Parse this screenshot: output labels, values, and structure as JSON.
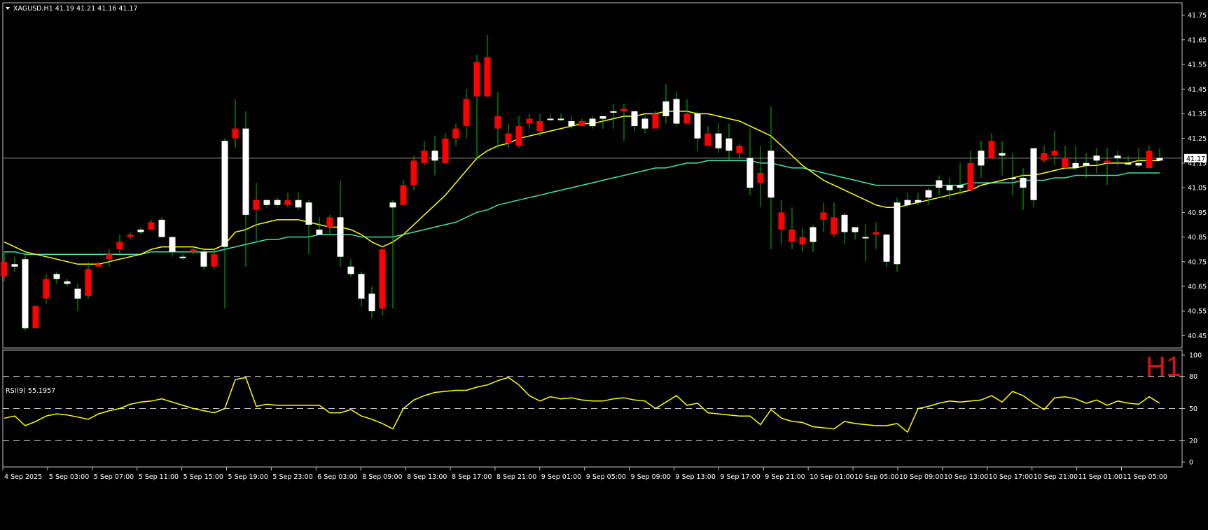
{
  "header": {
    "symbol_text": "XAGUSD,H1  41.19 41.21 41.16 41.17",
    "timeframe": "H1",
    "last_price_label": "41.17"
  },
  "rsi": {
    "label": "RSI(9) 55.1957",
    "levels": [
      80,
      50,
      20
    ],
    "axis_labels": [
      "100",
      "80",
      "50",
      "20",
      "0"
    ]
  },
  "colors": {
    "background": "#000000",
    "frame": "#c0c0c0",
    "bull_candle": "#ffffff",
    "bear_candle": "#ff0000",
    "wick": "#00c000",
    "ma_fast": "#ffff00",
    "ma_slow": "#40e0b0",
    "rsi_line": "#ffff00",
    "timeframe_label": "#e01010"
  },
  "chart_data": [
    {
      "type": "candlestick",
      "symbol": "XAGUSD",
      "ylim": [
        40.4,
        41.8
      ],
      "y_ticks": [
        "41.75",
        "41.65",
        "41.55",
        "41.45",
        "41.35",
        "41.25",
        "41.15",
        "41.05",
        "40.95",
        "40.85",
        "40.75",
        "40.65",
        "40.55",
        "40.45"
      ],
      "x_tick_labels": [
        "4 Sep 2025",
        "5 Sep 03:00",
        "5 Sep 07:00",
        "5 Sep 11:00",
        "5 Sep 15:00",
        "5 Sep 19:00",
        "5 Sep 23:00",
        "6 Sep 03:00",
        "8 Sep 09:00",
        "8 Sep 13:00",
        "8 Sep 17:00",
        "8 Sep 21:00",
        "9 Sep 01:00",
        "9 Sep 05:00",
        "9 Sep 09:00",
        "9 Sep 13:00",
        "9 Sep 17:00",
        "9 Sep 21:00",
        "10 Sep 01:00",
        "10 Sep 05:00",
        "10 Sep 09:00",
        "10 Sep 13:00",
        "10 Sep 17:00",
        "10 Sep 21:00",
        "11 Sep 01:00",
        "11 Sep 05:00"
      ],
      "last_price": 41.17,
      "ohlc": [
        [
          40.75,
          40.79,
          40.67,
          40.69
        ],
        [
          40.73,
          40.77,
          40.71,
          40.74
        ],
        [
          40.48,
          40.79,
          40.47,
          40.76
        ],
        [
          40.57,
          40.57,
          40.48,
          40.48
        ],
        [
          40.68,
          40.7,
          40.58,
          40.6
        ],
        [
          40.68,
          40.71,
          40.66,
          40.7
        ],
        [
          40.66,
          40.68,
          40.65,
          40.67
        ],
        [
          40.6,
          40.66,
          40.55,
          40.64
        ],
        [
          40.72,
          40.75,
          40.6,
          40.61
        ],
        [
          40.74,
          40.75,
          40.73,
          40.73
        ],
        [
          40.78,
          40.8,
          40.73,
          40.76
        ],
        [
          40.83,
          40.86,
          40.78,
          40.8
        ],
        [
          40.86,
          40.87,
          40.84,
          40.85
        ],
        [
          40.87,
          40.89,
          40.86,
          40.88
        ],
        [
          40.91,
          40.92,
          40.88,
          40.88
        ],
        [
          40.85,
          40.93,
          40.85,
          40.92
        ],
        [
          40.79,
          40.85,
          40.77,
          40.85
        ],
        [
          40.77,
          40.78,
          40.76,
          40.77
        ],
        [
          40.8,
          40.81,
          40.78,
          40.79
        ],
        [
          40.73,
          40.8,
          40.72,
          40.79
        ],
        [
          40.78,
          40.8,
          40.72,
          40.73
        ],
        [
          40.81,
          41.25,
          40.56,
          41.24
        ],
        [
          41.29,
          41.41,
          41.21,
          41.25
        ],
        [
          40.94,
          41.36,
          40.73,
          41.29
        ],
        [
          41.0,
          41.07,
          40.83,
          40.96
        ],
        [
          40.98,
          41.0,
          40.97,
          41.0
        ],
        [
          40.98,
          41.01,
          40.97,
          41.0
        ],
        [
          41.0,
          41.03,
          40.97,
          40.98
        ],
        [
          40.97,
          41.03,
          40.96,
          41.0
        ],
        [
          40.9,
          41.0,
          40.78,
          40.99
        ],
        [
          40.86,
          40.93,
          40.86,
          40.88
        ],
        [
          40.93,
          40.94,
          40.86,
          40.89
        ],
        [
          40.77,
          41.08,
          40.73,
          40.93
        ],
        [
          40.7,
          40.76,
          40.69,
          40.73
        ],
        [
          40.6,
          40.71,
          40.57,
          40.7
        ],
        [
          40.55,
          40.65,
          40.52,
          40.62
        ],
        [
          40.8,
          40.8,
          40.53,
          40.56
        ],
        [
          40.97,
          41.0,
          40.56,
          40.99
        ],
        [
          41.06,
          41.08,
          40.98,
          40.98
        ],
        [
          41.16,
          41.18,
          41.04,
          41.06
        ],
        [
          41.2,
          41.24,
          41.14,
          41.15
        ],
        [
          41.16,
          41.26,
          41.1,
          41.2
        ],
        [
          41.25,
          41.27,
          41.15,
          41.15
        ],
        [
          41.29,
          41.31,
          41.22,
          41.25
        ],
        [
          41.41,
          41.45,
          41.25,
          41.3
        ],
        [
          41.56,
          41.59,
          41.16,
          41.42
        ],
        [
          41.58,
          41.67,
          41.42,
          41.42
        ],
        [
          41.34,
          41.44,
          41.21,
          41.29
        ],
        [
          41.27,
          41.31,
          41.21,
          41.23
        ],
        [
          41.3,
          41.34,
          41.21,
          41.22
        ],
        [
          41.33,
          41.35,
          41.29,
          41.31
        ],
        [
          41.32,
          41.35,
          41.26,
          41.28
        ],
        [
          41.33,
          41.35,
          41.32,
          41.33
        ],
        [
          41.33,
          41.35,
          41.32,
          41.33
        ],
        [
          41.3,
          41.34,
          41.29,
          41.32
        ],
        [
          41.32,
          41.33,
          41.3,
          41.3
        ],
        [
          41.3,
          41.34,
          41.29,
          41.33
        ],
        [
          41.33,
          41.34,
          41.29,
          41.34
        ],
        [
          41.36,
          41.39,
          41.29,
          41.36
        ],
        [
          41.37,
          41.39,
          41.24,
          41.36
        ],
        [
          41.3,
          41.36,
          41.28,
          41.36
        ],
        [
          41.29,
          41.34,
          41.27,
          41.33
        ],
        [
          41.35,
          41.36,
          41.29,
          41.29
        ],
        [
          41.34,
          41.47,
          41.31,
          41.4
        ],
        [
          41.31,
          41.44,
          41.3,
          41.41
        ],
        [
          41.35,
          41.41,
          41.31,
          41.31
        ],
        [
          41.25,
          41.36,
          41.2,
          41.35
        ],
        [
          41.27,
          41.3,
          41.22,
          41.22
        ],
        [
          41.21,
          41.31,
          41.19,
          41.27
        ],
        [
          41.2,
          41.31,
          41.16,
          41.25
        ],
        [
          41.22,
          41.23,
          41.17,
          41.19
        ],
        [
          41.05,
          41.29,
          41.02,
          41.17
        ],
        [
          41.11,
          41.22,
          40.97,
          41.07
        ],
        [
          41.01,
          41.38,
          40.8,
          41.2
        ],
        [
          40.95,
          41.0,
          40.82,
          40.88
        ],
        [
          40.88,
          40.97,
          40.8,
          40.83
        ],
        [
          40.85,
          40.89,
          40.79,
          40.82
        ],
        [
          40.83,
          40.9,
          40.79,
          40.89
        ],
        [
          40.95,
          40.99,
          40.87,
          40.92
        ],
        [
          40.93,
          40.99,
          40.85,
          40.86
        ],
        [
          40.87,
          40.95,
          40.82,
          40.94
        ],
        [
          40.87,
          40.89,
          40.84,
          40.89
        ],
        [
          40.85,
          40.9,
          40.75,
          40.85
        ],
        [
          40.87,
          40.91,
          40.8,
          40.86
        ],
        [
          40.75,
          40.86,
          40.73,
          40.86
        ],
        [
          40.74,
          41.01,
          40.71,
          40.99
        ],
        [
          40.98,
          41.03,
          40.97,
          41.0
        ],
        [
          40.99,
          41.03,
          40.98,
          41.0
        ],
        [
          41.01,
          41.05,
          40.98,
          41.04
        ],
        [
          41.05,
          41.1,
          41.02,
          41.08
        ],
        [
          41.04,
          41.09,
          41.0,
          41.06
        ],
        [
          41.05,
          41.15,
          41.02,
          41.06
        ],
        [
          41.15,
          41.2,
          41.04,
          41.04
        ],
        [
          41.14,
          41.24,
          41.09,
          41.2
        ],
        [
          41.24,
          41.27,
          41.18,
          41.17
        ],
        [
          41.18,
          41.24,
          41.1,
          41.19
        ],
        [
          41.09,
          41.19,
          41.02,
          41.09
        ],
        [
          41.05,
          41.13,
          40.96,
          41.09
        ],
        [
          41.0,
          41.21,
          40.97,
          41.21
        ],
        [
          41.19,
          41.22,
          41.15,
          41.16
        ],
        [
          41.2,
          41.28,
          41.14,
          41.18
        ],
        [
          41.17,
          41.22,
          41.14,
          41.13
        ],
        [
          41.13,
          41.22,
          41.12,
          41.15
        ],
        [
          41.14,
          41.19,
          41.09,
          41.15
        ],
        [
          41.16,
          41.21,
          41.11,
          41.18
        ],
        [
          41.16,
          41.21,
          41.06,
          41.15
        ],
        [
          41.17,
          41.2,
          41.14,
          41.18
        ],
        [
          41.15,
          41.18,
          41.14,
          41.15
        ],
        [
          41.14,
          41.21,
          41.13,
          41.15
        ],
        [
          41.2,
          41.22,
          41.13,
          41.13
        ],
        [
          41.16,
          41.21,
          41.16,
          41.17
        ]
      ],
      "ma_fast": [
        40.83,
        40.81,
        40.79,
        40.78,
        40.77,
        40.76,
        40.75,
        40.74,
        40.74,
        40.74,
        40.75,
        40.76,
        40.77,
        40.78,
        40.8,
        40.81,
        40.81,
        40.81,
        40.81,
        40.8,
        40.8,
        40.82,
        40.87,
        40.88,
        40.9,
        40.91,
        40.92,
        40.92,
        40.92,
        40.91,
        40.9,
        40.89,
        40.89,
        40.88,
        40.86,
        40.83,
        40.81,
        40.83,
        40.86,
        40.9,
        40.94,
        40.98,
        41.02,
        41.07,
        41.12,
        41.17,
        41.2,
        41.22,
        41.23,
        41.25,
        41.26,
        41.27,
        41.28,
        41.29,
        41.3,
        41.31,
        41.31,
        41.32,
        41.33,
        41.34,
        41.34,
        41.35,
        41.35,
        41.36,
        41.36,
        41.36,
        41.35,
        41.35,
        41.34,
        41.33,
        41.32,
        41.3,
        41.28,
        41.26,
        41.22,
        41.18,
        41.14,
        41.11,
        41.08,
        41.06,
        41.04,
        41.02,
        41.0,
        40.98,
        40.97,
        40.97,
        40.98,
        40.99,
        41.0,
        41.01,
        41.02,
        41.03,
        41.04,
        41.06,
        41.07,
        41.08,
        41.09,
        41.1,
        41.1,
        41.11,
        41.12,
        41.13,
        41.13,
        41.14,
        41.14,
        41.15,
        41.15,
        41.15,
        41.16,
        41.16,
        41.16
      ],
      "ma_slow": [
        40.79,
        40.79,
        40.78,
        40.78,
        40.78,
        40.78,
        40.78,
        40.78,
        40.78,
        40.78,
        40.78,
        40.78,
        40.78,
        40.78,
        40.79,
        40.79,
        40.79,
        40.79,
        40.79,
        40.79,
        40.79,
        40.8,
        40.81,
        40.82,
        40.83,
        40.84,
        40.84,
        40.85,
        40.85,
        40.85,
        40.86,
        40.86,
        40.86,
        40.86,
        40.85,
        40.85,
        40.85,
        40.85,
        40.86,
        40.87,
        40.88,
        40.89,
        40.9,
        40.91,
        40.93,
        40.95,
        40.96,
        40.98,
        40.99,
        41.0,
        41.01,
        41.02,
        41.03,
        41.04,
        41.05,
        41.06,
        41.07,
        41.08,
        41.09,
        41.1,
        41.11,
        41.12,
        41.13,
        41.13,
        41.14,
        41.15,
        41.15,
        41.16,
        41.16,
        41.16,
        41.16,
        41.16,
        41.15,
        41.15,
        41.14,
        41.13,
        41.13,
        41.12,
        41.11,
        41.1,
        41.09,
        41.08,
        41.07,
        41.06,
        41.06,
        41.06,
        41.06,
        41.06,
        41.06,
        41.06,
        41.06,
        41.06,
        41.07,
        41.07,
        41.07,
        41.07,
        41.07,
        41.08,
        41.08,
        41.08,
        41.09,
        41.09,
        41.1,
        41.1,
        41.1,
        41.1,
        41.1,
        41.11,
        41.11,
        41.11,
        41.11
      ]
    },
    {
      "type": "line",
      "name": "RSI(9)",
      "ylim": [
        0,
        100
      ],
      "levels": [
        20,
        50,
        80
      ],
      "values": [
        41,
        43,
        34,
        38,
        43,
        45,
        44,
        42,
        40,
        45,
        48,
        50,
        54,
        56,
        57,
        59,
        56,
        53,
        50,
        48,
        46,
        50,
        77,
        79,
        52,
        54,
        53,
        53,
        53,
        53,
        53,
        46,
        46,
        49,
        43,
        40,
        36,
        31,
        50,
        58,
        62,
        65,
        66,
        67,
        67,
        70,
        72,
        76,
        79,
        72,
        62,
        57,
        61,
        59,
        60,
        58,
        57,
        57,
        59,
        60,
        58,
        57,
        50,
        56,
        62,
        53,
        55,
        46,
        45,
        44,
        43,
        43,
        35,
        49,
        41,
        38,
        37,
        33,
        32,
        31,
        38,
        36,
        35,
        34,
        34,
        36,
        28,
        50,
        52,
        55,
        57,
        56,
        57,
        58,
        62,
        56,
        66,
        62,
        55,
        49,
        60,
        61,
        59,
        55,
        58,
        53,
        57,
        55,
        54,
        61,
        55
      ]
    }
  ]
}
